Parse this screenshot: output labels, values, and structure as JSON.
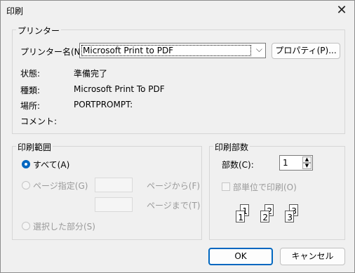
{
  "window": {
    "title": "印刷"
  },
  "printer_group": {
    "label": "プリンター",
    "name_label": "プリンター名(N):",
    "name_value": "Microsoft Print to PDF",
    "properties_button": "プロパティ(P)...",
    "status_label": "状態:",
    "status_value": "準備完了",
    "type_label": "種類:",
    "type_value": "Microsoft Print To PDF",
    "where_label": "場所:",
    "where_value": "PORTPROMPT:",
    "comment_label": "コメント:",
    "comment_value": ""
  },
  "range_group": {
    "label": "印刷範囲",
    "all": "すべて(A)",
    "pages": "ページ指定(G)",
    "from_label": "ページから(F)",
    "to_label": "ページまで(T)",
    "selection": "選択した部分(S)",
    "selected": "all"
  },
  "copies_group": {
    "label": "印刷部数",
    "copies_label": "部数(C):",
    "copies_value": "1",
    "collate_label": "部単位で印刷(O)",
    "collate_checked": false,
    "collate_pages": [
      "1",
      "1",
      "2",
      "2",
      "3",
      "3"
    ]
  },
  "footer": {
    "ok": "OK",
    "cancel": "キャンセル"
  },
  "colors": {
    "accent": "#0067c0"
  }
}
